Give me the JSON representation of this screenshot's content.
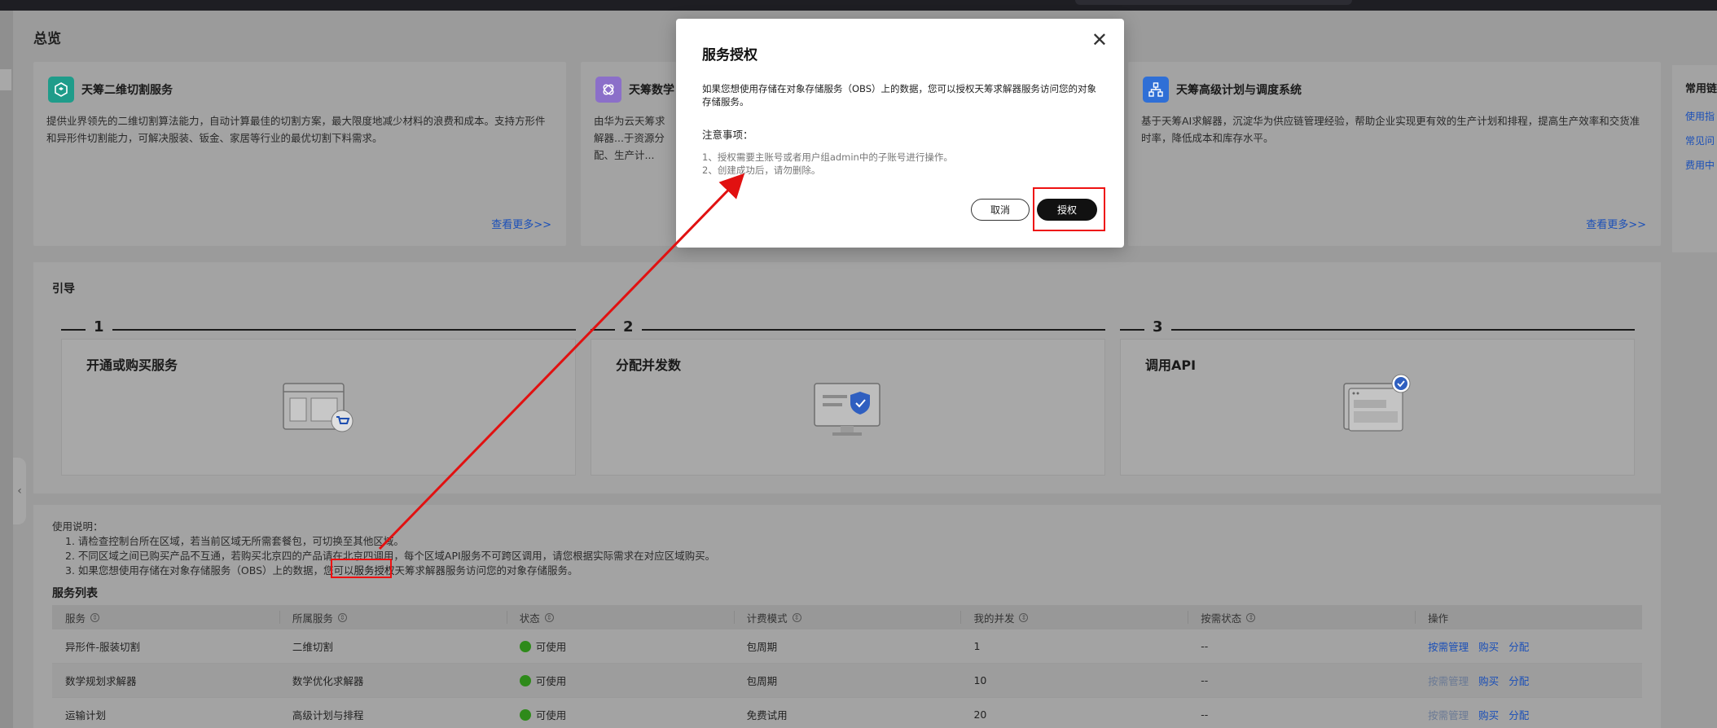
{
  "page": {
    "title": "总览"
  },
  "services": [
    {
      "title": "天筹二维切割服务",
      "desc": "提供业界领先的二维切割算法能力，自动计算最佳的切割方案，最大限度地减少材料的浪费和成本。支持方形件和异形件切割能力，可解决服装、钣金、家居等行业的最优切割下料需求。",
      "more": "查看更多>>",
      "icon_color": "#1f9c8a",
      "icon": "cube-icon"
    },
    {
      "title": "天筹数学",
      "desc": "由华为云天筹求解器...于资源分配、生产计...率，增强决策水平",
      "more": "",
      "icon_color": "#8b6fc9",
      "icon": "orbit-icon"
    },
    {
      "title": "天筹高级计划与调度系统",
      "desc": "基于天筹AI求解器，沉淀华为供应链管理经验，帮助企业实现更有效的生产计划和排程，提高生产效率和交货准时率，降低成本和库存水平。",
      "more": "查看更多>>",
      "icon_color": "#2f6fd6",
      "icon": "hierarchy-icon"
    }
  ],
  "side": {
    "title": "常用链",
    "links": [
      "使用指",
      "常见问",
      "费用中"
    ]
  },
  "guide": {
    "title": "引导",
    "steps": [
      {
        "num": "1",
        "label": "开通或购买服务"
      },
      {
        "num": "2",
        "label": "分配并发数"
      },
      {
        "num": "3",
        "label": "调用API"
      }
    ]
  },
  "notes": {
    "header": "使用说明：",
    "line1": "1. 请检查控制台所在区域，若当前区域无所需套餐包，可切换至其他区域。",
    "line2": "2. 不同区域之间已购买产品不互通，若购买北京四的产品请在北京四调用，每个区域API服务不可跨区调用，请您根据实际需求在对应区域购买。",
    "line3_pre": "3. 如果您想使用存储在对象存储服务（OBS）上的数据，您可以",
    "line3_link": "服务授权",
    "line3_post": "天筹求解器服务访问您的对象存储服务。"
  },
  "list": {
    "title": "服务列表",
    "columns": [
      "服务",
      "所属服务",
      "状态",
      "计费模式",
      "我的并发",
      "按需状态",
      "操作"
    ],
    "rows": [
      {
        "service": "异形件-服装切割",
        "parent": "二维切割",
        "status": "可使用",
        "billing": "包周期",
        "concurrency": "1",
        "ondemand": "--",
        "ops": [
          "按需管理",
          "购买",
          "分配"
        ],
        "first_disabled": false
      },
      {
        "service": "数学规划求解器",
        "parent": "数学优化求解器",
        "status": "可使用",
        "billing": "包周期",
        "concurrency": "10",
        "ondemand": "--",
        "ops": [
          "按需管理",
          "购买",
          "分配"
        ],
        "first_disabled": true
      },
      {
        "service": "运输计划",
        "parent": "高级计划与排程",
        "status": "可使用",
        "billing": "免费试用",
        "concurrency": "20",
        "ondemand": "--",
        "ops": [
          "按需管理",
          "购买",
          "分配"
        ],
        "first_disabled": true
      }
    ]
  },
  "modal": {
    "title": "服务授权",
    "body": "如果您想使用存储在对象存储服务（OBS）上的数据，您可以授权天筹求解器服务访问您的对象存储服务。",
    "notice_title": "注意事项：",
    "notice1": "1、授权需要主账号或者用户组admin中的子账号进行操作。",
    "notice2": "2、创建成功后，请勿删除。",
    "cancel": "取消",
    "ok": "授权"
  },
  "colors": {
    "annotation": "#e11111",
    "link": "#1a4fb8",
    "status_ok": "#2e8a1a"
  }
}
